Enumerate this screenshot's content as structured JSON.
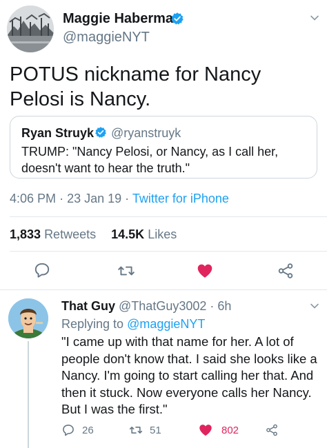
{
  "tweet": {
    "author_name": "Maggie Haberman",
    "author_handle": "@maggieNYT",
    "text": "POTUS nickname for Nancy Pelosi is Nancy.",
    "time": "4:06 PM",
    "date": "23 Jan 19",
    "source": "Twitter for iPhone",
    "retweets_count": "1,833",
    "retweets_label": "Retweets",
    "likes_count": "14.5K",
    "likes_label": "Likes",
    "liked": true
  },
  "quoted_tweet": {
    "author_name": "Ryan Struyk",
    "author_handle": "@ryanstruyk",
    "text": "TRUMP: \"Nancy Pelosi, or Nancy, as I call her, doesn't want to hear the truth.\""
  },
  "reply": {
    "author_name": "That Guy",
    "author_handle": "@ThatGuy3002",
    "time_ago": "6h",
    "replying_to_label": "Replying to",
    "replying_to_handle": "@maggieNYT",
    "text": "\"I came up with that name for her. A lot of people don't know that. I said she looks like a Nancy. I'm going to start calling her that. And then it stuck. Now everyone calls her Nancy. But I was the first.\"",
    "replies_count": "26",
    "retweets_count": "51",
    "likes_count": "802",
    "liked": true
  },
  "colors": {
    "accent": "#1da1f2",
    "like": "#e0245e",
    "secondary_text": "#657786",
    "border": "#e1e8ed"
  },
  "icons": {
    "verified": "verified-badge-icon",
    "reply": "reply-icon",
    "retweet": "retweet-icon",
    "like": "heart-icon",
    "share": "share-icon",
    "menu": "chevron-down-icon"
  }
}
